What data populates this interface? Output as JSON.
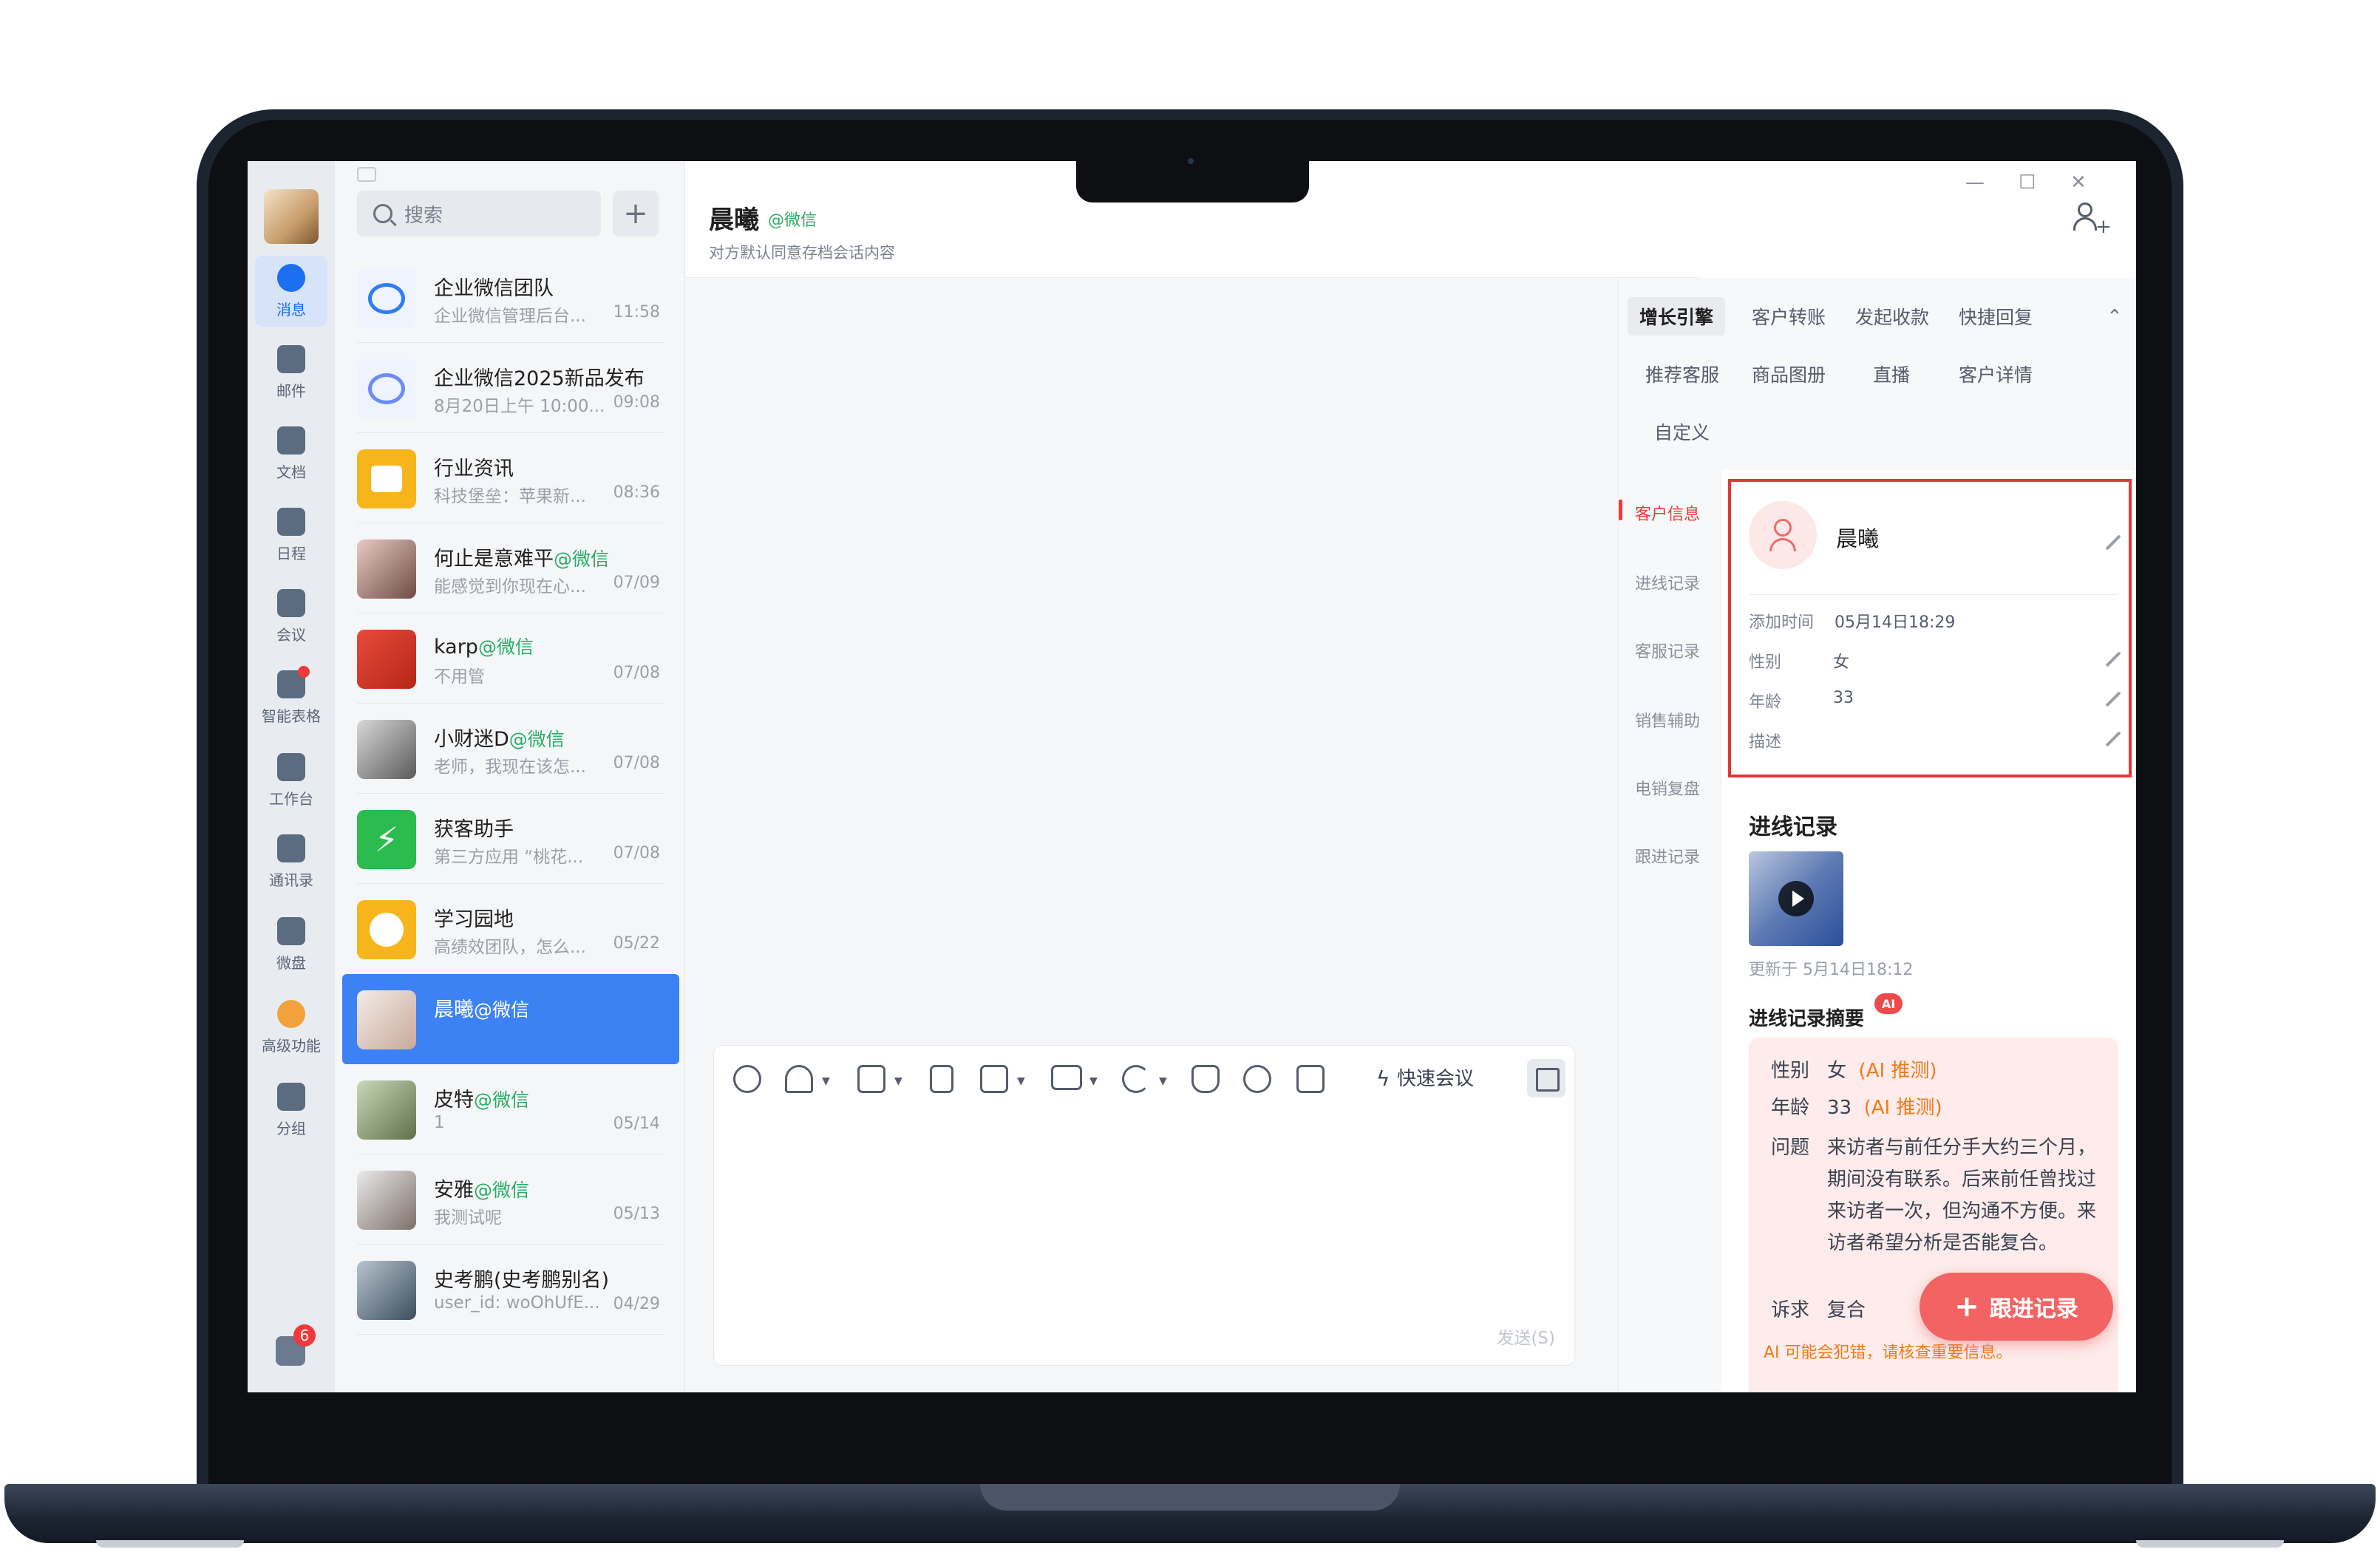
{
  "rail": {
    "items": [
      {
        "label": "消息",
        "icon": "message-icon"
      },
      {
        "label": "邮件",
        "icon": "mail-icon"
      },
      {
        "label": "文档",
        "icon": "document-icon"
      },
      {
        "label": "日程",
        "icon": "calendar-icon"
      },
      {
        "label": "会议",
        "icon": "meeting-icon"
      },
      {
        "label": "智能表格",
        "icon": "smart-table-icon"
      },
      {
        "label": "工作台",
        "icon": "workbench-icon"
      },
      {
        "label": "通讯录",
        "icon": "contacts-icon"
      },
      {
        "label": "微盘",
        "icon": "drive-icon"
      },
      {
        "label": "高级功能",
        "icon": "premium-icon"
      },
      {
        "label": "分组",
        "icon": "group-icon"
      }
    ],
    "bottom_badge": "6"
  },
  "search": {
    "placeholder": "搜索",
    "add_symbol": "+"
  },
  "conversations": [
    {
      "name": "企业微信团队",
      "tag": "",
      "preview": "企业微信管理后台...",
      "time": "11:58"
    },
    {
      "name": "企业微信2025新品发布",
      "tag": "",
      "preview": "8月20日上午 10:00...",
      "time": "09:08"
    },
    {
      "name": "行业资讯",
      "tag": "",
      "preview": "科技堡垒：苹果新...",
      "time": "08:36"
    },
    {
      "name": "何止是意难平",
      "tag": "@微信",
      "preview": "能感觉到你现在心...",
      "time": "07/09"
    },
    {
      "name": "karp",
      "tag": "@微信",
      "preview": "不用管",
      "time": "07/08"
    },
    {
      "name": "小财迷D",
      "tag": "@微信",
      "preview": "老师，我现在该怎...",
      "time": "07/08"
    },
    {
      "name": "获客助手",
      "tag": "",
      "preview": "第三方应用 “桃花...",
      "time": "07/08"
    },
    {
      "name": "学习园地",
      "tag": "",
      "preview": "高绩效团队，怎么...",
      "time": "05/22"
    },
    {
      "name": "晨曦",
      "tag": "@微信",
      "preview": "",
      "time": ""
    },
    {
      "name": "皮特",
      "tag": "@微信",
      "preview": "1",
      "time": "05/14"
    },
    {
      "name": "安雅",
      "tag": "@微信",
      "preview": "我测试呢",
      "time": "05/13"
    },
    {
      "name": "史考鹏(史考鹏别名)",
      "tag": "",
      "preview": "user_id: woOhUfE...",
      "time": "04/29"
    }
  ],
  "chat": {
    "title": "晨曦",
    "title_tag": "@微信",
    "subtitle": "对方默认同意存档会话内容",
    "quick_meeting": "快速会议",
    "send_label": "发送(S)"
  },
  "window": {
    "minimize": "—",
    "maximize": "☐",
    "close": "✕"
  },
  "right_panel": {
    "tabs_row1": [
      "增长引擎",
      "客户转账",
      "发起收款",
      "快捷回复"
    ],
    "tabs_row2": [
      "推荐客服",
      "商品图册",
      "直播",
      "客户详情"
    ],
    "tabs_row3": [
      "自定义"
    ],
    "collapse_symbol": "⌃",
    "vnav": [
      "客户信息",
      "进线记录",
      "客服记录",
      "销售辅助",
      "电销复盘",
      "跟进记录"
    ],
    "customer": {
      "name": "晨曦",
      "fields": [
        {
          "key": "添加时间",
          "value": "05月14日18:29"
        },
        {
          "key": "性别",
          "value": "女"
        },
        {
          "key": "年龄",
          "value": "33"
        },
        {
          "key": "描述",
          "value": ""
        }
      ]
    },
    "inbound": {
      "title": "进线记录",
      "updated": "更新于 5月14日18:12",
      "summary_title": "进线记录摘要",
      "ai_badge": "AI",
      "summary": [
        {
          "key": "性别",
          "value": "女",
          "ai": "(AI 推测)"
        },
        {
          "key": "年龄",
          "value": "33",
          "ai": "(AI 推测)"
        },
        {
          "key": "问题",
          "value": "来访者与前任分手大约三个月，期间没有联系。后来前任曾找过来访者一次，但沟通不方便。来访者希望分析是否能复合。"
        },
        {
          "key": "诉求",
          "value": "复合"
        }
      ],
      "ai_warning": "AI 可能会犯错，请核查重要信息。"
    },
    "fab": {
      "plus": "+",
      "label": "跟进记录"
    }
  },
  "colors": {
    "accent": "#3d82f4",
    "wechat_green": "#2aae67",
    "alert_red": "#e23838",
    "ai_orange": "#f07a1a"
  }
}
